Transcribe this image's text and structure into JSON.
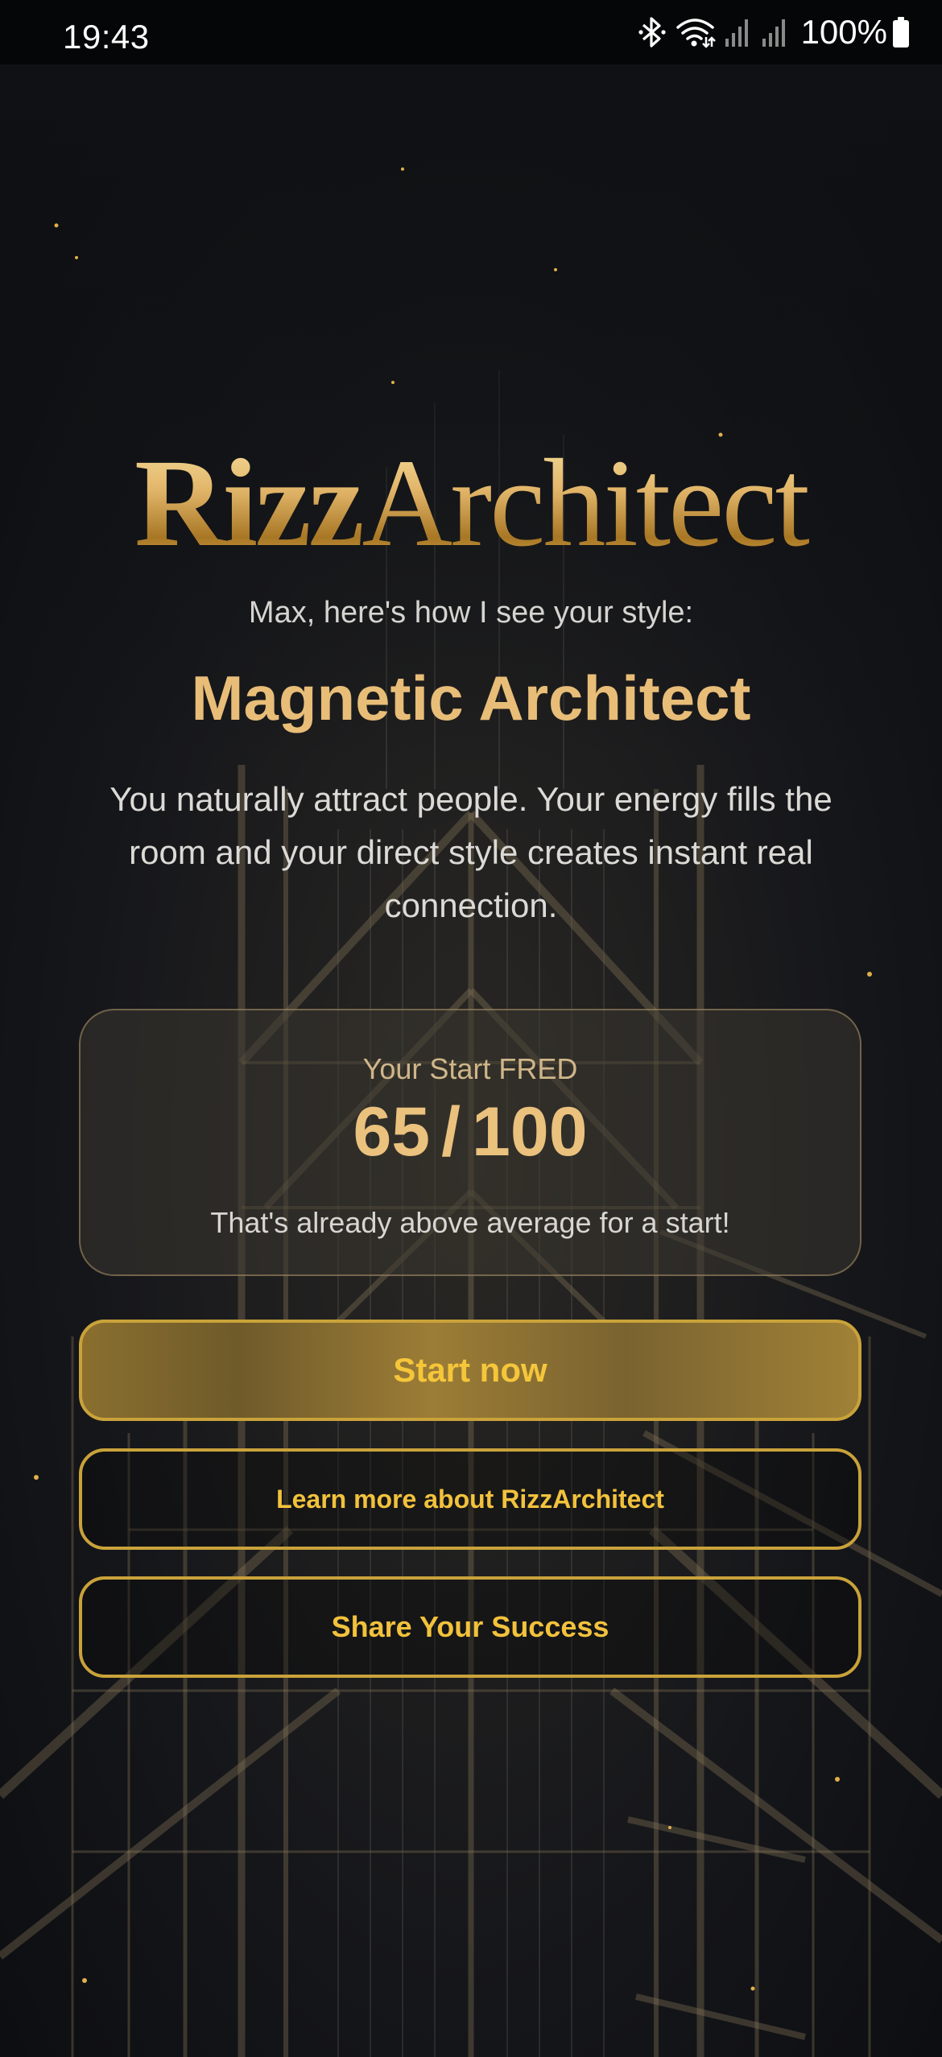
{
  "status_bar": {
    "time": "19:43",
    "battery": "100%",
    "icons": [
      "bluetooth-icon",
      "wifi-icon",
      "signal-icon",
      "signal-icon",
      "battery-icon"
    ]
  },
  "app": {
    "logo_part1": "Rizz",
    "logo_part2": "Architect"
  },
  "result": {
    "greeting": "Max, here's how I see your style:",
    "style_name": "Magnetic Architect",
    "description": "You naturally attract people. Your energy fills the room and your direct style creates instant real connection."
  },
  "score_card": {
    "label": "Your Start FRED",
    "score": "65",
    "separator": "/",
    "max": "100",
    "note": "That's already above average for a start!"
  },
  "buttons": {
    "start": "Start now",
    "learn_more": "Learn more about RizzArchitect",
    "share": "Share Your Success"
  },
  "colors": {
    "accent_gold": "#eac17d",
    "button_text": "#f2c23c",
    "background": "#0d0f12"
  }
}
